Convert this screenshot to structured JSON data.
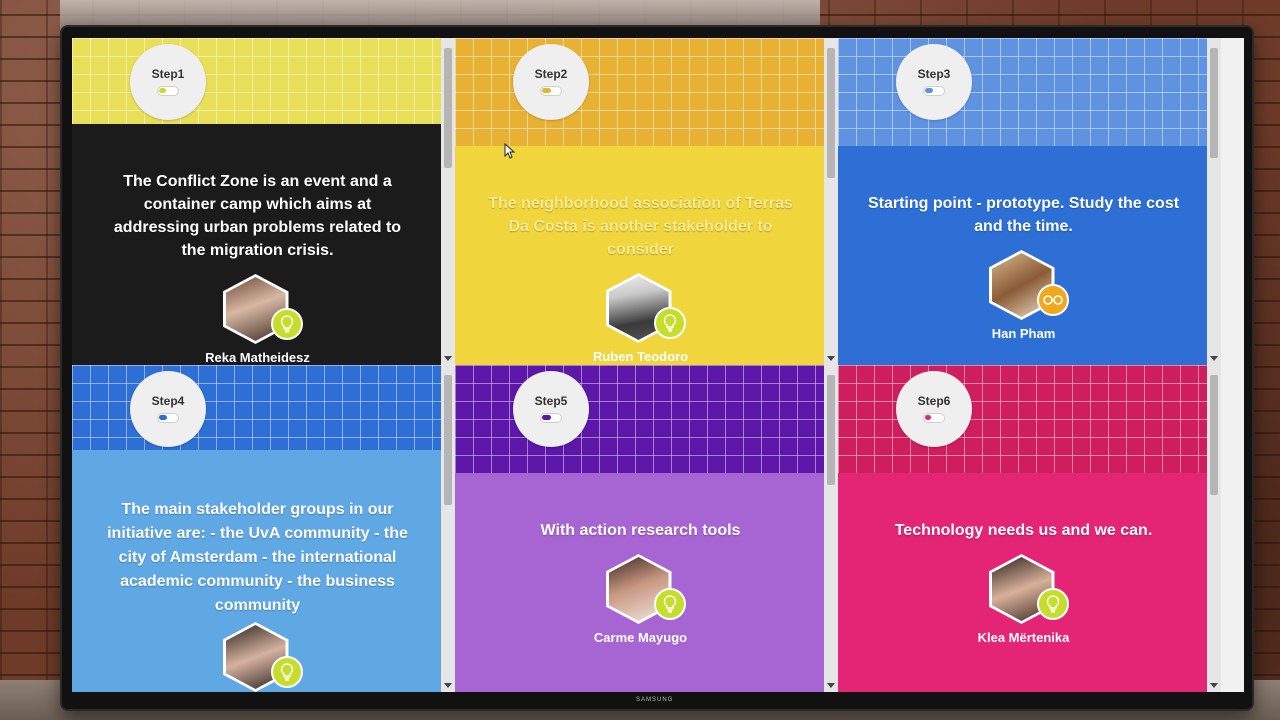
{
  "colors": {
    "yellow": "#f0d53c",
    "mustard": "#e7b234",
    "blue_light": "#5fa8e3",
    "blue": "#2d6fd4",
    "purple_dark": "#5c16a8",
    "purple_light": "#a765d3",
    "magenta": "#e42475",
    "black": "#1b1b1b",
    "lime": "#c6de2b",
    "amber": "#f0a91e"
  },
  "tiles": [
    {
      "step": "Step1",
      "caption": "The Conflict Zone is an event and a container camp which aims at addressing urban problems related to the migration crisis.",
      "person": "Reka Matheidesz",
      "badge_icon": "lightbulb-icon",
      "top_color": "#e8df58",
      "bottom_color": "#1b1b1b",
      "progress": 0.35,
      "toggle_color": "#c6de2b"
    },
    {
      "step": "Step2",
      "caption": "The neighborhood association of Terras Da Costa is another stakeholder to consider",
      "person": "Ruben Teodoro",
      "badge_icon": "lightbulb-icon",
      "top_color": "#e7b234",
      "bottom_color": "#f0d53c",
      "progress": 0.45,
      "toggle_color": "#e7b234"
    },
    {
      "step": "Step3",
      "caption": "Starting point - prototype. Study the cost and the time.",
      "person": "Han Pham",
      "badge_icon": "glasses-icon",
      "top_color": "#5f93e0",
      "bottom_color": "#2d6fd4",
      "progress": 0.4,
      "toggle_color": "#5f93e0"
    },
    {
      "step": "Step4",
      "caption": "The main stakeholder groups in our initiative are: - the UvA community - the city of Amsterdam - the international academic community - the business community",
      "person": "",
      "badge_icon": "lightbulb-icon",
      "top_color": "#2d6fd4",
      "bottom_color": "#5fa8e3",
      "progress": 0.4,
      "toggle_color": "#2d6fd4"
    },
    {
      "step": "Step5",
      "caption": "With action research tools",
      "person": "Carme Mayugo",
      "badge_icon": "lightbulb-icon",
      "top_color": "#5c16a8",
      "bottom_color": "#a765d3",
      "progress": 0.45,
      "toggle_color": "#5c16a8"
    },
    {
      "step": "Step6",
      "caption": "Technology needs us and we can.",
      "person": "Klea Mërtenika",
      "badge_icon": "lightbulb-icon",
      "top_color": "#cf1e5e",
      "bottom_color": "#e42475",
      "progress": 0.3,
      "toggle_color": "#e42475"
    }
  ],
  "tv": {
    "brand": "SAMSUNG"
  }
}
